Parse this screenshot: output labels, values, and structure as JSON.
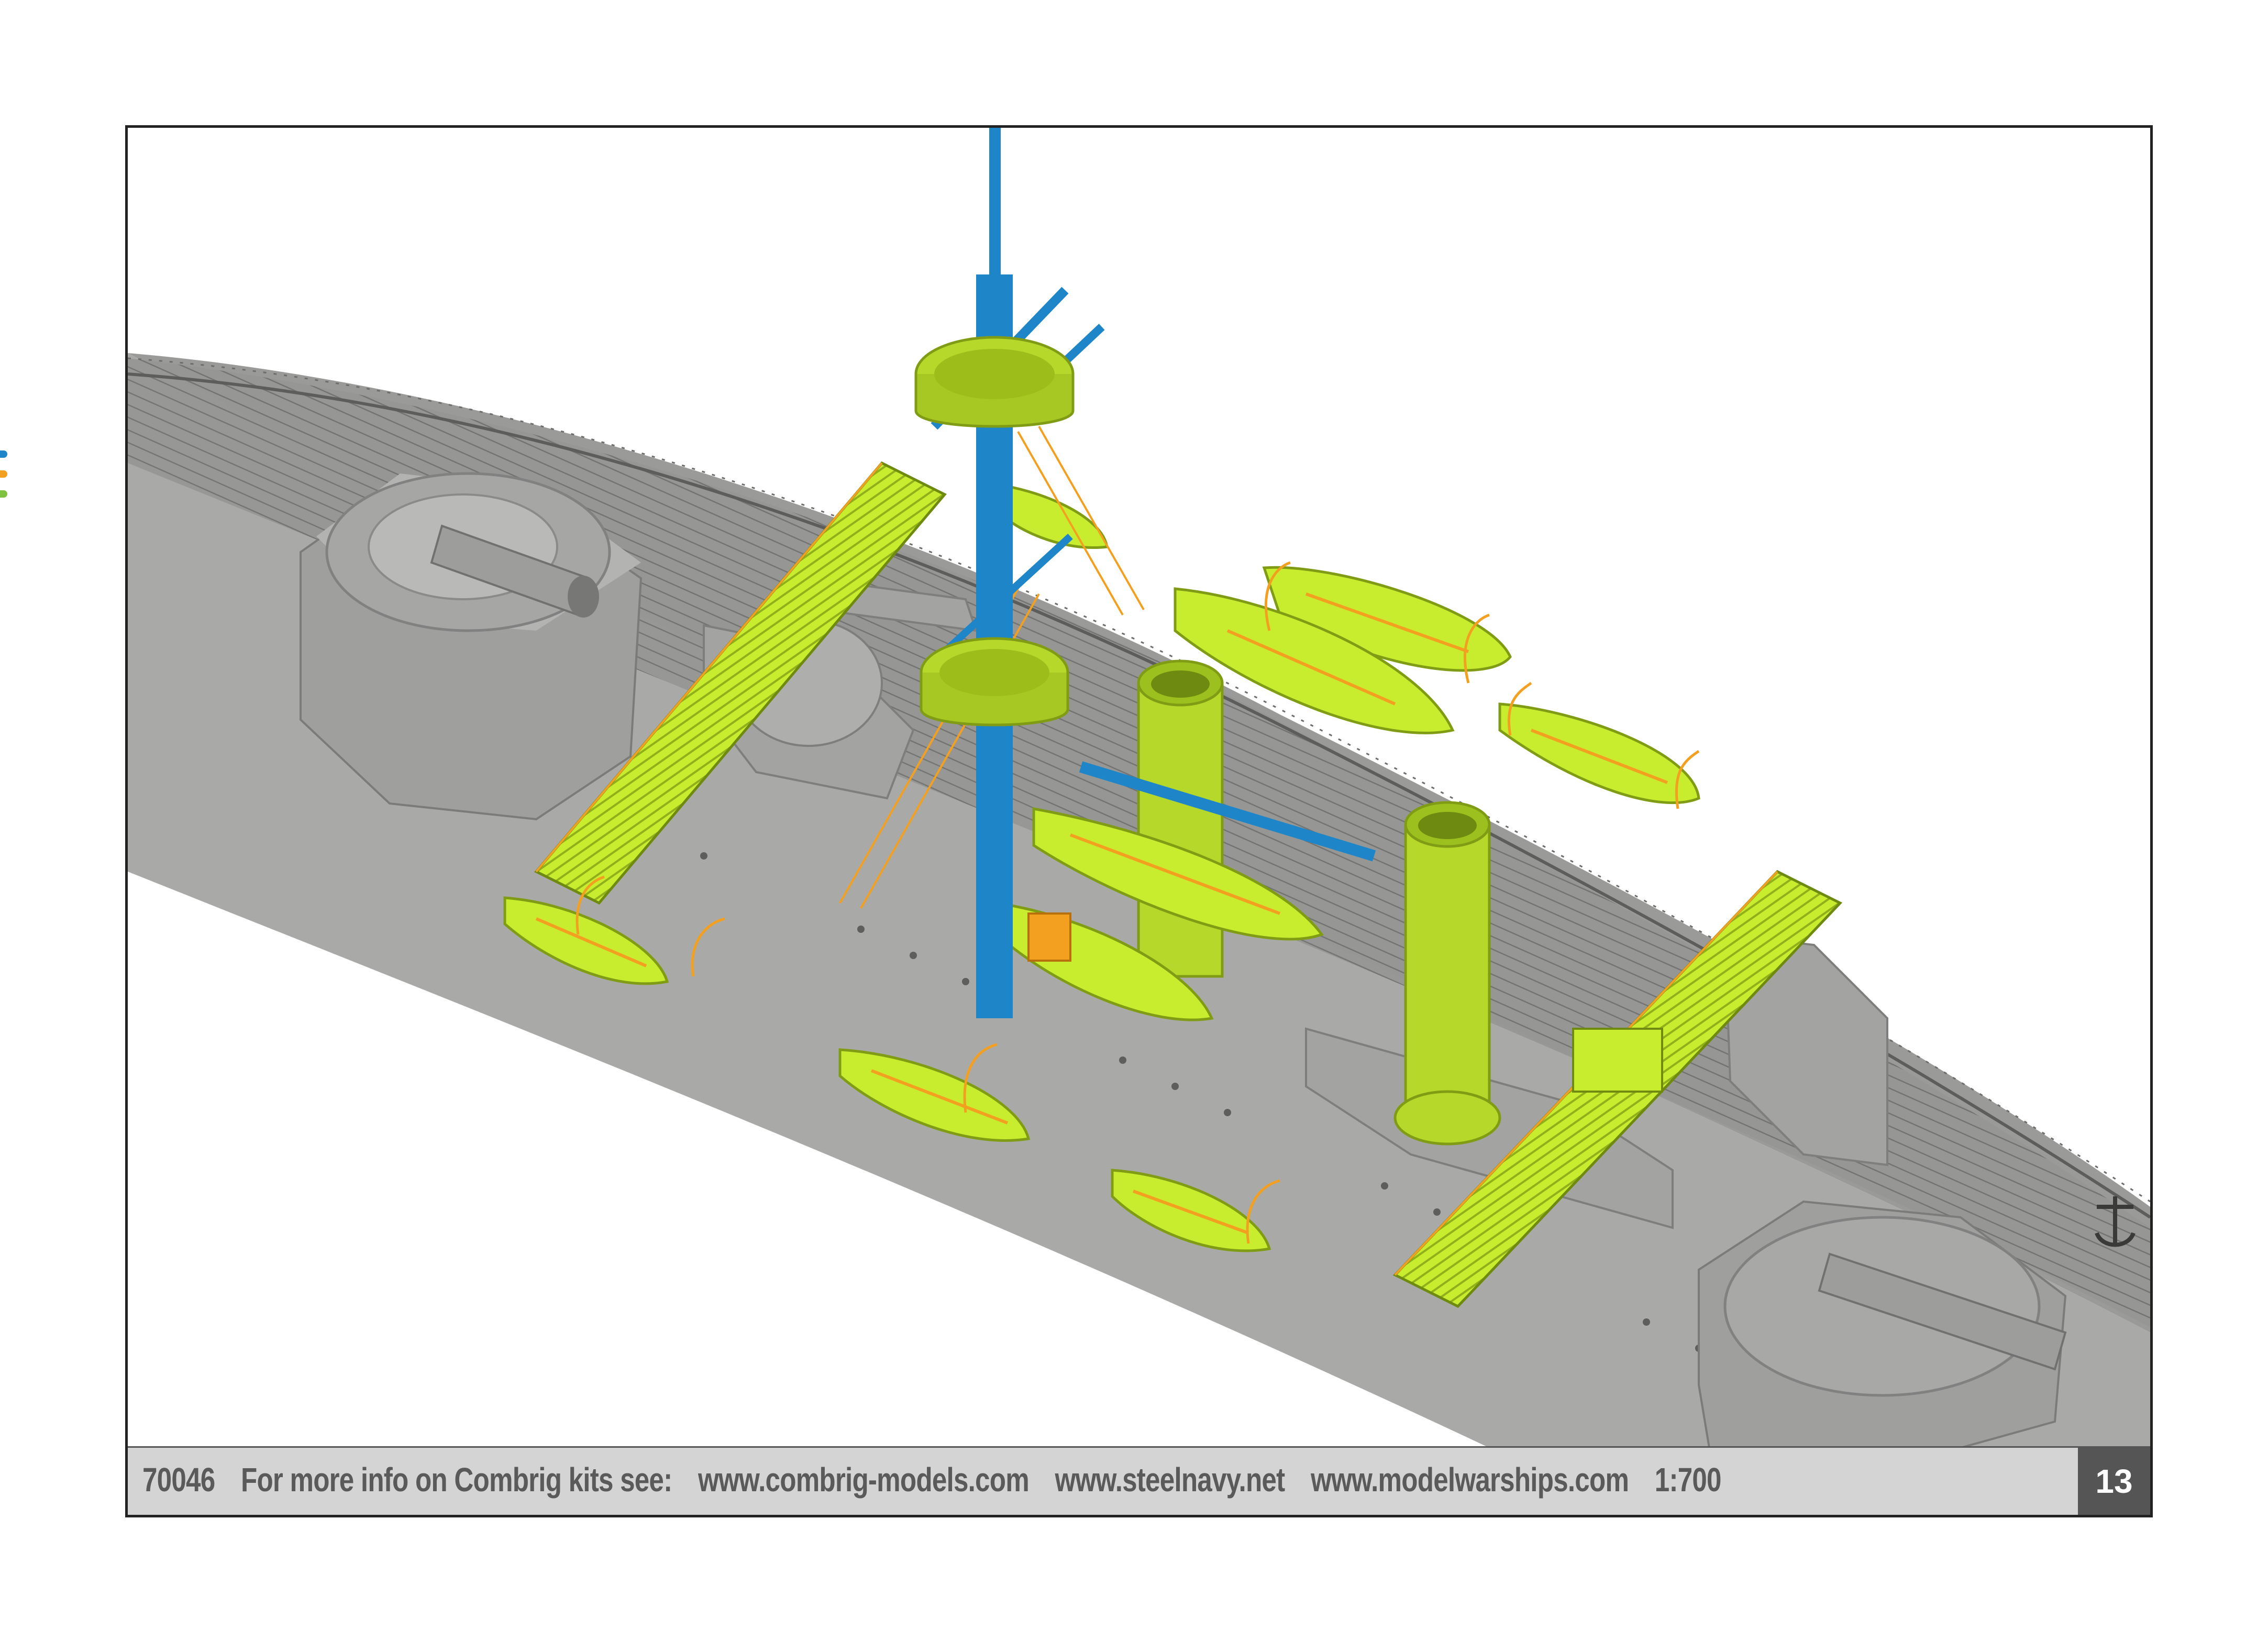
{
  "footer": {
    "kit_number": "70046",
    "info_text": "For more info on Combrig kits see:",
    "site_1": "www.combrig-models.com",
    "site_2": "www.steelnavy.net",
    "site_3": "www.modelwarships.com",
    "scale": "1:700",
    "page_number": "13"
  },
  "colors": {
    "hull_gray": "#a9aaa8",
    "deck_gray": "#8f908e",
    "part_green": "#c8ec2e",
    "mast_blue": "#1e86c8",
    "detail_orange": "#f3a020",
    "footer_bg": "#d4d4d4",
    "page_badge": "#555555"
  },
  "edge_marks": [
    "#1e86c8",
    "#f3a020",
    "#7fc241"
  ]
}
